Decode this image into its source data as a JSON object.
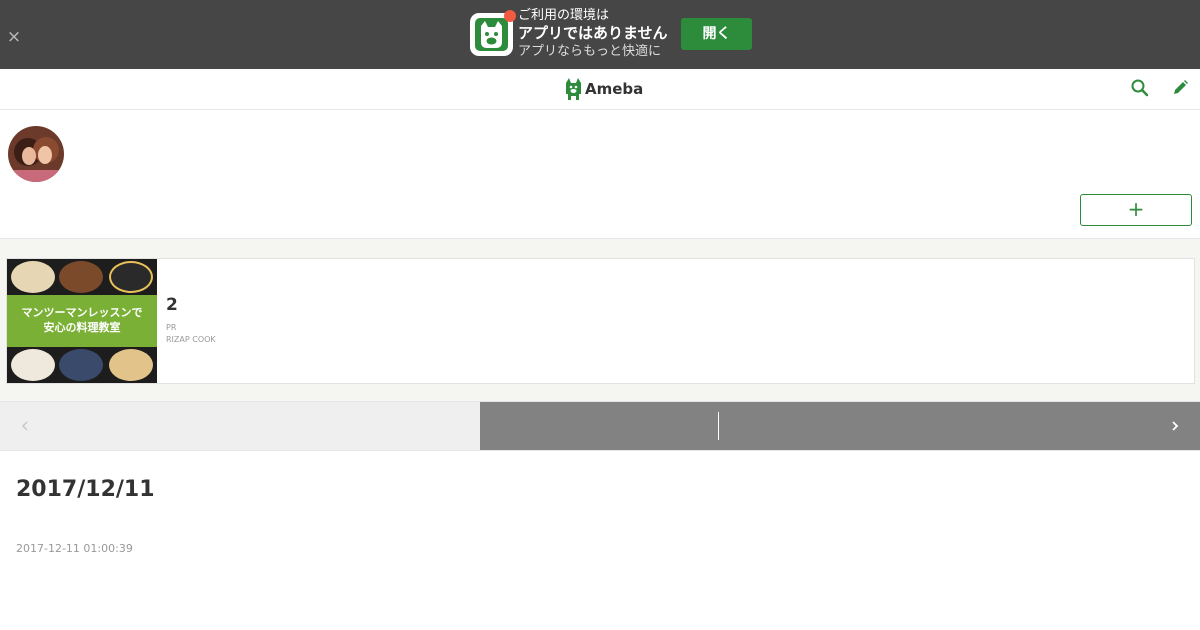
{
  "app_banner": {
    "close_label": "×",
    "line1": "ご利用の環境は",
    "line2": "アプリではありません",
    "line3": "アプリならもっと快適に",
    "open_button": "開く",
    "app_icon": "ameba-bear-icon"
  },
  "header": {
    "logo_text": "Ameba",
    "search_icon": "search-icon",
    "edit_icon": "pencil-icon"
  },
  "profile": {
    "blog_title": "",
    "follow_button": "+"
  },
  "ad": {
    "image_text_line1": "マンツーマンレッスンで",
    "image_text_line2": "安心の料理教室",
    "number": "2",
    "pr_label": "PR",
    "sponsor": "RIZAP COOK"
  },
  "pager": {
    "prev_icon": "chevron-left-icon",
    "next_icon": "chevron-right-icon"
  },
  "entry": {
    "title": "2017/12/11",
    "datetime": "2017-12-11 01:00:39"
  },
  "colors": {
    "banner_bg": "#464646",
    "brand_green": "#2d8c3c",
    "badge_red": "#f25b41",
    "pager_next_bg": "#828282"
  }
}
